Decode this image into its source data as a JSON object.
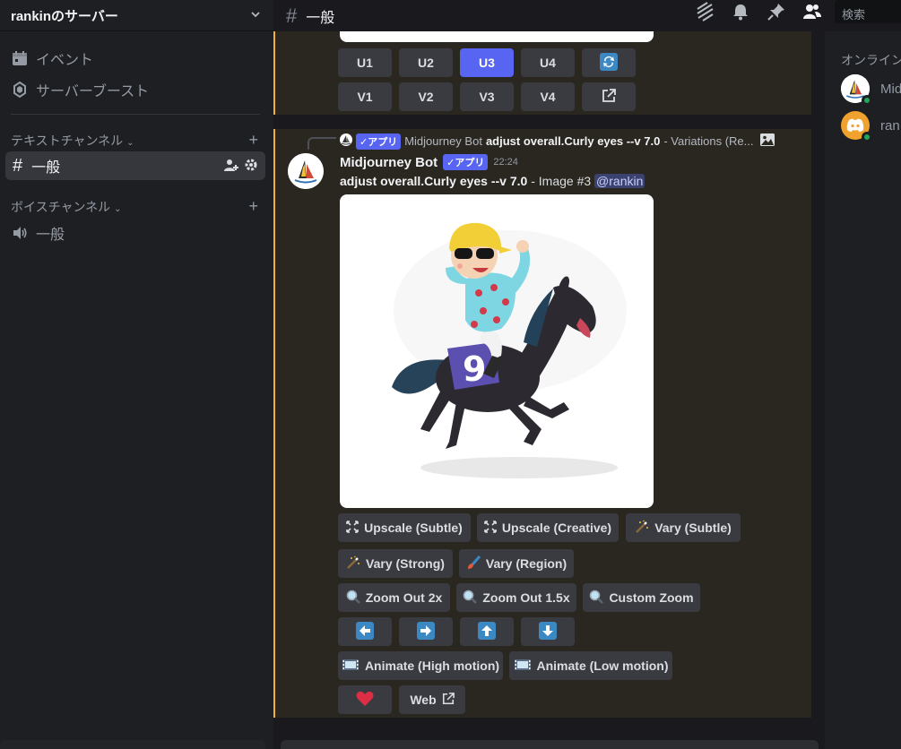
{
  "server": {
    "name": "rankinのサーバー"
  },
  "sidebar": {
    "items": [
      {
        "label": "イベント",
        "icon": "calendar-icon"
      },
      {
        "label": "サーバーブースト",
        "icon": "boost-icon"
      }
    ],
    "text_category": "テキストチャンネル",
    "text_channels": [
      {
        "label": "一般",
        "active": true
      }
    ],
    "voice_category": "ボイスチャンネル",
    "voice_channels": [
      {
        "label": "一般"
      }
    ]
  },
  "header": {
    "channel": "一般",
    "search_placeholder": "検索"
  },
  "message_top": {
    "row1": [
      "U1",
      "U2",
      "U3",
      "U4"
    ],
    "row2": [
      "V1",
      "V2",
      "V3",
      "V4"
    ],
    "selected": "U3"
  },
  "message": {
    "reply_badge": "✓アプリ",
    "reply_author": "Midjourney Bot",
    "reply_prompt": "adjust overall.Curly eyes --v 7.0",
    "reply_suffix": " - Variations (Re...",
    "author": "Midjourney Bot",
    "badge": "✓アプリ",
    "time": "22:24",
    "prompt": "adjust overall.Curly eyes --v 7.0",
    "suffix": " - Image #3 ",
    "mention": "@rankin",
    "jockey_number": "9"
  },
  "buttons": {
    "upscale_subtle": "Upscale (Subtle)",
    "upscale_creative": "Upscale (Creative)",
    "vary_subtle": "Vary (Subtle)",
    "vary_strong": "Vary (Strong)",
    "vary_region": "Vary (Region)",
    "zoom_out_2x": "Zoom Out 2x",
    "zoom_out_15x": "Zoom Out 1.5x",
    "custom_zoom": "Custom Zoom",
    "animate_high": "Animate (High motion)",
    "animate_low": "Animate (Low motion)",
    "web": "Web"
  },
  "members": {
    "title": "オンライン",
    "list": [
      {
        "name": "Mid",
        "icon": "midjourney-avatar-icon"
      },
      {
        "name": "ran",
        "icon": "discord-avatar-icon",
        "color": "#f0a22e"
      }
    ]
  },
  "colors": {
    "accent": "#5865f2",
    "highlight_border": "#f0b232",
    "online": "#23a55a"
  }
}
